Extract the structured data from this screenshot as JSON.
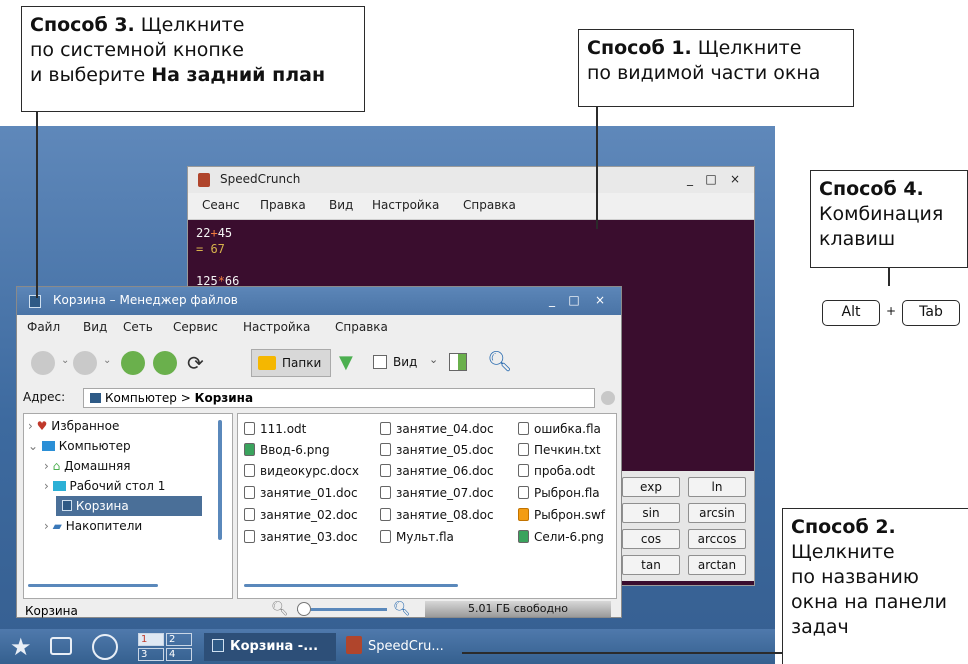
{
  "callouts": {
    "c3": {
      "bold": "Способ 3.",
      "line1": " Щелкните",
      "line2": "по системной кнопке",
      "line3a": "и выберите ",
      "line3b": "На задний план"
    },
    "c1": {
      "bold": "Способ 1.",
      "line1": " Щелкните",
      "line2": "по видимой части окна"
    },
    "c4": {
      "bold": "Способ 4.",
      "line2": "Комбинация",
      "line3": "клавиш"
    },
    "c2": {
      "bold": "Способ 2.",
      "line2": "Щелкните",
      "line3": "по названию",
      "line4": "окна на панели",
      "line5": "задач"
    }
  },
  "keys": {
    "alt": "Alt",
    "plus": "+",
    "tab": "Tab"
  },
  "speedcrunch": {
    "title": "SpeedCrunch",
    "menu": [
      "Сеанс",
      "Правка",
      "Вид",
      "Настройка",
      "Справка"
    ],
    "expr1a": "22",
    "expr1op": "+",
    "expr1b": "45",
    "result1": "= 67",
    "expr2a": "125",
    "expr2op": "*",
    "expr2b": "66",
    "functions": [
      [
        "exp",
        "ln"
      ],
      [
        "sin",
        "arcsin"
      ],
      [
        "cos",
        "arccos"
      ],
      [
        "tan",
        "arctan"
      ]
    ]
  },
  "fm": {
    "title": "Корзина – Менеджер файлов",
    "menu": [
      "Файл",
      "Вид",
      "Сеть",
      "Сервис",
      "Настройка",
      "Справка"
    ],
    "folders_label": "Папки",
    "view_label": "Вид",
    "addr_label": "Адрес:",
    "addr_path": "Компьютер",
    "addr_sep": ">",
    "addr_current": "Корзина",
    "tree": [
      "Избранное",
      "Компьютер",
      "Домашняя",
      "Рабочий стол 1",
      "Корзина",
      "Накопители"
    ],
    "files_col1": [
      "111.odt",
      "Ввод-6.png",
      "видеокурс.docx",
      "занятие_01.doc",
      "занятие_02.doc",
      "занятие_03.doc"
    ],
    "files_col2": [
      "занятие_04.doc",
      "занятие_05.doc",
      "занятие_06.doc",
      "занятие_07.doc",
      "занятие_08.doc",
      "Мульт.fla"
    ],
    "files_col3": [
      "ошибка.fla",
      "Печкин.txt",
      "проба.odt",
      "Рыброн.fla",
      "Рыброн.swf",
      "Сели-6.png"
    ],
    "status_left": "Корзина",
    "free_space": "5.01 ГБ свободно"
  },
  "taskbar": {
    "ws": [
      "1",
      "2",
      "3",
      "4"
    ],
    "task1": "Корзина -...",
    "task2": "SpeedCru..."
  },
  "colors": {
    "desktop": "#4a74a6",
    "terminal": "#3a0d2e",
    "accent": "#f5b700"
  }
}
